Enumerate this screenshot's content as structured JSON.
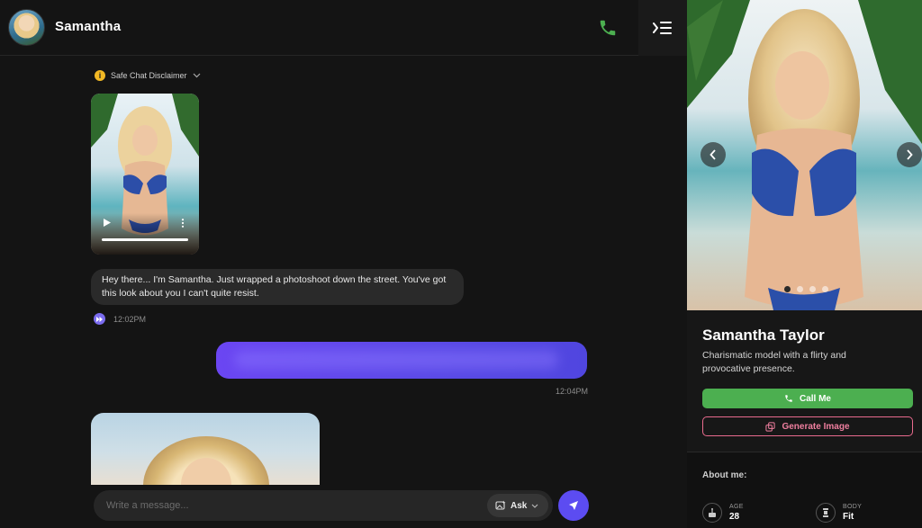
{
  "header": {
    "name": "Samantha"
  },
  "disclaimer": {
    "label": "Safe Chat Disclaimer"
  },
  "video": {
    "progress_percent": 100
  },
  "messages": {
    "incoming_text": "Hey there... I'm Samantha. Just wrapped a photoshoot down the street. You've got this look about you I can't quite resist.",
    "incoming_time": "12:02PM",
    "outgoing_time": "12:04PM"
  },
  "composer": {
    "placeholder": "Write a message...",
    "ask_label": "Ask"
  },
  "profile": {
    "name": "Samantha Taylor",
    "bio": "Charismatic model with a flirty and provocative presence.",
    "call_label": "Call Me",
    "generate_label": "Generate Image",
    "about_title": "About me:",
    "stats": [
      {
        "label": "AGE",
        "value": "28",
        "icon": "cake-icon"
      },
      {
        "label": "BODY",
        "value": "Fit",
        "icon": "body-icon"
      }
    ],
    "carousel_active_index": 0,
    "carousel_count": 4
  },
  "colors": {
    "accent": "#5c4cf1",
    "call_green": "#4caf50",
    "generate_pink": "#e96b8e",
    "disclaimer_yellow": "#f2b824"
  }
}
